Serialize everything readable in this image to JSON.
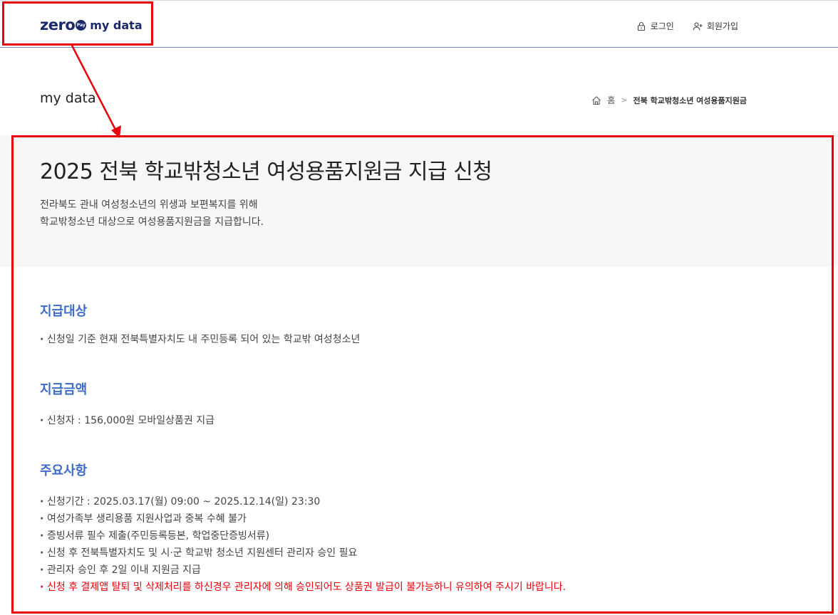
{
  "header": {
    "logo_main": "zero",
    "logo_badge": "Pay",
    "logo_sub": "my data",
    "nav": {
      "login": "로그인",
      "signup": "회원가입"
    }
  },
  "page": {
    "heading": "my data",
    "breadcrumb": {
      "home": "홈",
      "current": "전북 학교밖청소년 여성용품지원금"
    }
  },
  "hero": {
    "title": "2025 전북 학교밖청소년 여성용품지원금 지급 신청",
    "desc_line1": "전라북도 관내 여성청소년의 위생과 보편복지를 위해",
    "desc_line2": "학교밖청소년 대상으로 여성용품지원금을 지급합니다."
  },
  "sections": {
    "target": {
      "title": "지급대상",
      "items": [
        "신청일 기준 현재 전북특별자치도 내 주민등록 되어 있는 학교밖 여성청소년"
      ]
    },
    "amount": {
      "title": "지급금액",
      "items": [
        "신청자 : 156,000원 모바일상품권 지급"
      ]
    },
    "notes": {
      "title": "주요사항",
      "items": [
        "신청기간 : 2025.03.17(월) 09:00 ~ 2025.12.14(일) 23:30",
        "여성가족부 생리용품 지원사업과 중복 수혜 불가",
        "증빙서류 필수 제출(주민등록등본, 학업중단증빙서류)",
        "신청 후 전북특별자치도 및 시·군 학교밖 청소년 지원센터 관리자 승인 필요",
        "관리자 승인 후 2일 이내 지원금 지급",
        "신청 후 결제앱 탈퇴 및 삭제처리를 하신경우 관리자에 의해 승인되어도 상품권 발급이 불가능하니 유의하여 주시기 바랍니다."
      ]
    }
  },
  "colors": {
    "brand": "#1b2a6b",
    "section_title": "#3d6cc9",
    "warning": "#e8000b",
    "annotation": "#e8000b"
  }
}
